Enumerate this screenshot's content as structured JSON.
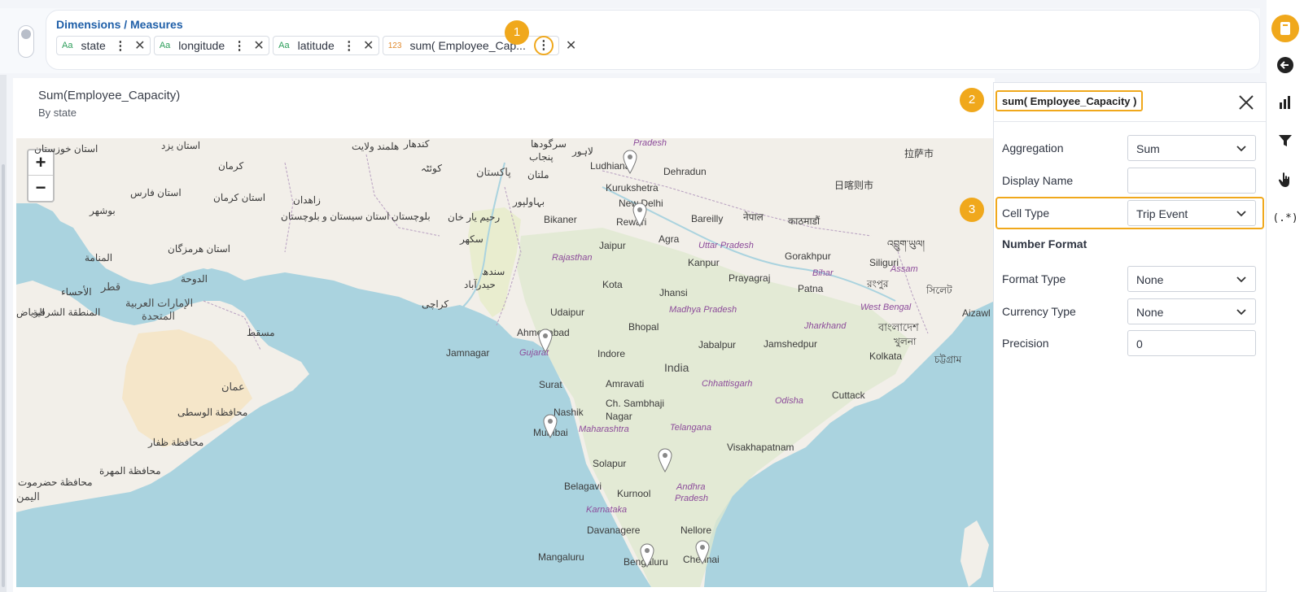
{
  "dimensions": {
    "title": "Dimensions / Measures",
    "chips": [
      {
        "type": "Aa",
        "label": "state"
      },
      {
        "type": "Aa",
        "label": "longitude"
      },
      {
        "type": "Aa",
        "label": "latitude"
      },
      {
        "type": "123",
        "label": "sum( Employee_Cap..."
      }
    ]
  },
  "badges": [
    "1",
    "2",
    "3"
  ],
  "chart": {
    "title": "Sum(Employee_Capacity)",
    "subtitle": "By state"
  },
  "map": {
    "zoom_in": "+",
    "zoom_out": "−",
    "labels": {
      "ludhiana": "Ludhiana",
      "dehradun": "Dehradun",
      "kurukshetra": "Kurukshetra",
      "newdelhi": "New Delhi",
      "bikaner": "Bikaner",
      "rewari": "Rewari",
      "bareilly": "Bareilly",
      "jaipur": "Jaipur",
      "agra": "Agra",
      "uttarpradesh": "Uttar Pradesh",
      "kanpur": "Kanpur",
      "prayagraj": "Prayagraj",
      "rajasthan": "Rajasthan",
      "kota": "Kota",
      "jhansi": "Jhansi",
      "patna": "Patna",
      "gorakhpur": "Gorakhpur",
      "siliguri": "Siliguri",
      "bihar": "Bihar",
      "udaipur": "Udaipur",
      "madhyapradesh": "Madhya Pradesh",
      "bhopal": "Bhopal",
      "ahmedabad": "Ahmedabad",
      "jamnagar": "Jamnagar",
      "gujarat": "Gujarat",
      "indore": "Indore",
      "jabalpur": "Jabalpur",
      "jharkhand": "Jharkhand",
      "jamshedpur": "Jamshedpur",
      "kolkata": "Kolkata",
      "westbengal": "West Bengal",
      "india": "India",
      "surat": "Surat",
      "amravati": "Amravati",
      "chhattisgarh": "Chhattisgarh",
      "odisha": "Odisha",
      "cuttack": "Cuttack",
      "nashik": "Nashik",
      "chsambhaji": "Ch. Sambhaji",
      "nagar": "Nagar",
      "mumbai": "Mumbai",
      "maharashtra": "Maharashtra",
      "telangana": "Telangana",
      "visakhapatnam": "Visakhapatnam",
      "solapur": "Solapur",
      "belagavi": "Belagavi",
      "kurnool": "Kurnool",
      "andhrapradesh1": "Andhra",
      "andhrapradesh2": "Pradesh",
      "karnataka": "Karnataka",
      "davanagere": "Davanagere",
      "nellore": "Nellore",
      "mangaluru": "Mangaluru",
      "bengaluru": "Bengaluru",
      "chennai": "Chennai",
      "kathmandu": "काठमाडौं",
      "nepal": "नेपाल",
      "assam": "Assam",
      "aizawl": "Aizawl",
      "pakistan": "پاکستان",
      "multan": "ملتان",
      "karachi": "کراچی",
      "hyderabad_pk": "حیدرآباد",
      "sukkur": "سکھر",
      "muscat": "مسقط",
      "oman": "عمان",
      "uae1": "الإمارات العربية",
      "uae2": "المتحدة",
      "doha": "الدوحة",
      "manama": "المنامة",
      "qatar": "قطر",
      "kerman": "کرمان",
      "zahedan": "زاهدان",
      "kandahar": "کندهار",
      "quetta": "کوئٹہ",
      "lahore": "لاہور",
      "bahawalpur": "بہاولپور",
      "rahimyarkhan": "رحیم یار خان",
      "balochistan": "بلوچستان",
      "bangladesh": "বাংলাদেশ",
      "khulna": "খুলনা",
      "chattogram": "চট্টগ্রাম",
      "sylhet": "সিলেট",
      "rangpur": "রংপুর",
      "lhasa": "拉萨市",
      "rikaze": "日喀则市",
      "bhutan": "འབྲུག་ཡུལ།",
      "yemen": "اليمن",
      "punjab": "پنجاب",
      "sindh": "سندھ",
      "ahsa": "الأحساء",
      "riyadh": "الرياض",
      "eastprov": "المنطقة الشرقية",
      "wusta": "محافظة الوسطى",
      "dhofar": "محافظة ظفار",
      "mahra": "محافظة المهرة",
      "hadramaut": "محافظة حضرموت",
      "bushehr": "بوشهر",
      "hormozgan": "استان هرمزگان",
      "fars": "استان فارس",
      "kermanprov": "استان کرمان",
      "sistan": "استان سیستان و بلوچستان",
      "yazd": "استان یزد",
      "pradesh_top": "Pradesh",
      "sargodha": "سرگودھا",
      "helmand": "هلمند ولایت",
      "khuzestan": "استان خوزستان"
    }
  },
  "panel": {
    "title": "sum( Employee_Capacity )",
    "aggregation_label": "Aggregation",
    "aggregation_value": "Sum",
    "display_name_label": "Display Name",
    "display_name_value": "",
    "cell_type_label": "Cell Type",
    "cell_type_value": "Trip Event",
    "number_format_heading": "Number Format",
    "format_type_label": "Format Type",
    "format_type_value": "None",
    "currency_type_label": "Currency Type",
    "currency_type_value": "None",
    "precision_label": "Precision",
    "precision_value": "0"
  },
  "rail": {
    "regex_label": "(.*)"
  },
  "colors": {
    "accent": "#f0a81c",
    "link": "#1f5fa8",
    "water": "#aad3df",
    "land": "#f2efe9"
  }
}
